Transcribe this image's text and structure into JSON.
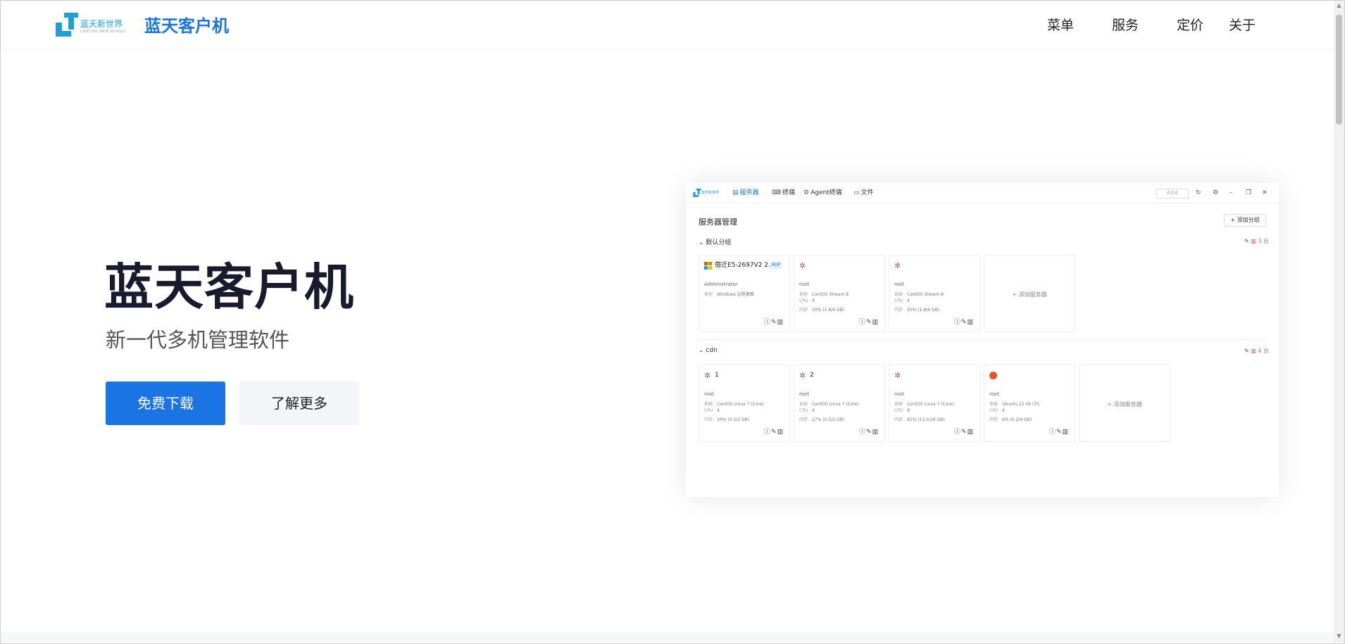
{
  "nav": {
    "logo_text": "蓝天新世界",
    "logo_sub": "LANTIAN NEW WORLD",
    "brand": "蓝天客户机",
    "links": [
      "菜单",
      "服务",
      "定价",
      "关于"
    ]
  },
  "hero": {
    "title": "蓝天客户机",
    "subtitle": "新一代多机管理软件",
    "primary_button": "免费下载",
    "secondary_button": "了解更多"
  },
  "app": {
    "logo_text": "蓝天新世界",
    "tabs": [
      "服务器",
      "终端",
      "Agent终端",
      "文件"
    ],
    "status": "0.0.0",
    "page_title": "服务器管理",
    "add_group": "添加分组",
    "groups": [
      {
        "name": "默认分组",
        "count": "3 台",
        "servers": [
          {
            "name": "宿迁E5-2697V2 2...",
            "badge": "RDP",
            "user": "Administrator",
            "rows": [
              [
                "类型",
                "Windows 远程桌面"
              ]
            ]
          },
          {
            "name": "",
            "badge": "",
            "user": "root",
            "rows": [
              [
                "系统",
                "CentOS Stream 8"
              ],
              [
                "CPU",
                "4"
              ],
              [
                "内存",
                "50% (1.8/4 GB)"
              ]
            ]
          },
          {
            "name": "",
            "badge": "",
            "user": "root",
            "rows": [
              [
                "系统",
                "CentOS Stream 8"
              ],
              [
                "CPU",
                "4"
              ],
              [
                "内存",
                "50% (1.8/4 GB)"
              ]
            ]
          }
        ],
        "add_server": "添加服务器"
      },
      {
        "name": "cdn",
        "count": "4 台",
        "servers": [
          {
            "name": "1",
            "badge": "",
            "user": "root",
            "rows": [
              [
                "系统",
                "CentOS Linux 7 (Core)"
              ],
              [
                "CPU",
                "4"
              ],
              [
                "内存",
                "29% (0.5/2 GB)"
              ]
            ]
          },
          {
            "name": "2",
            "badge": "",
            "user": "root",
            "rows": [
              [
                "系统",
                "CentOS Linux 7 (Core)"
              ],
              [
                "CPU",
                "4"
              ],
              [
                "内存",
                "27% (0.5/2 GB)"
              ]
            ]
          },
          {
            "name": "",
            "badge": "",
            "user": "root",
            "rows": [
              [
                "系统",
                "CentOS Linux 7 (Core)"
              ],
              [
                "CPU",
                "8"
              ],
              [
                "内存",
                "81% (13.0/16 GB)"
              ]
            ]
          },
          {
            "name": "",
            "badge": "",
            "user": "root",
            "rows": [
              [
                "系统",
                "Ubuntu 22.04 LTS"
              ],
              [
                "CPU",
                "4"
              ],
              [
                "内存",
                "6% (0.2/4 GB)"
              ]
            ]
          }
        ],
        "add_server": "添加服务器"
      }
    ]
  },
  "colors": {
    "brand_blue": "#1b74e4",
    "logo_cyan": "#1ea0d8",
    "delete_red": "#e04343"
  }
}
